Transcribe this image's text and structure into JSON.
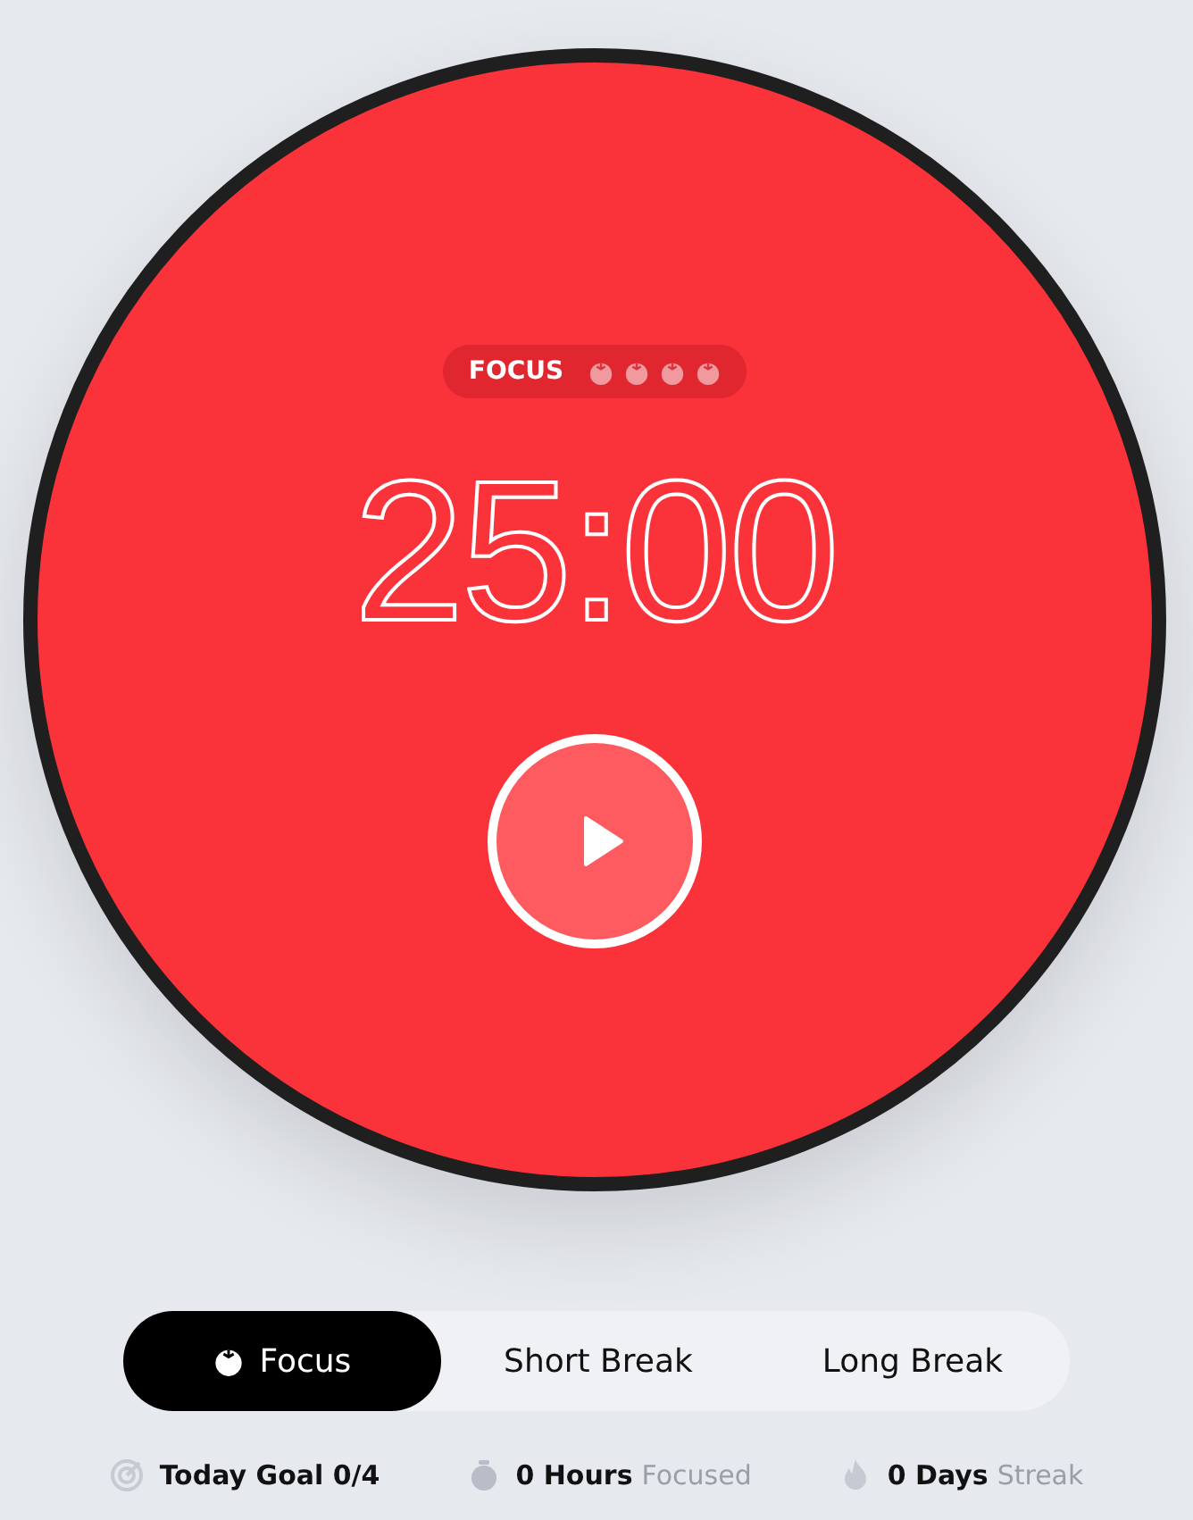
{
  "timer": {
    "mode_label": "FOCUS",
    "time": "25:00",
    "running": false,
    "sessions": [
      {
        "done": false
      },
      {
        "done": false
      },
      {
        "done": false
      },
      {
        "done": false
      }
    ]
  },
  "modes": [
    {
      "label": "Focus",
      "selected": true
    },
    {
      "label": "Short Break",
      "selected": false
    },
    {
      "label": "Long Break",
      "selected": false
    }
  ],
  "stats": [
    {
      "kind": "goal",
      "value": "Today Goal 0/4"
    },
    {
      "kind": "hours",
      "value": "0 Hours",
      "label": "Focused"
    },
    {
      "kind": "streak",
      "value": "0 Days",
      "label": "Streak"
    }
  ]
}
